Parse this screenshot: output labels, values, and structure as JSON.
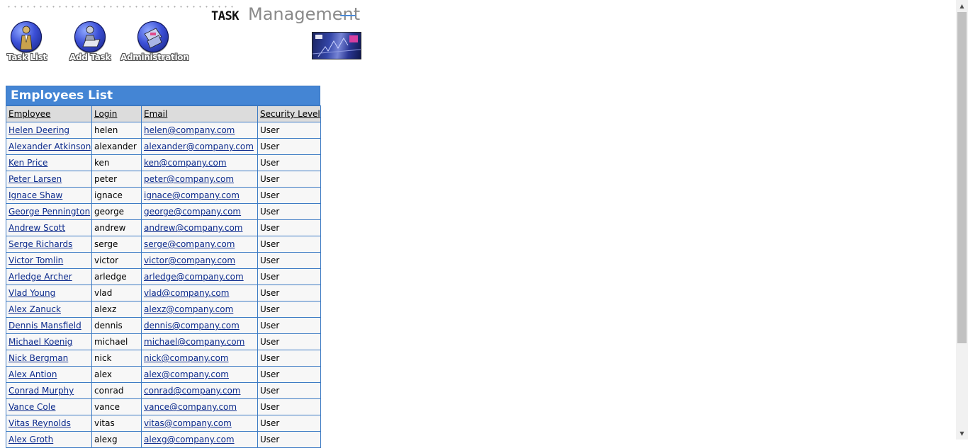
{
  "logo": {
    "task": "TASK",
    "management": "Management"
  },
  "nav": [
    {
      "label": "Task List",
      "icon": "task-list-icon"
    },
    {
      "label": "Add Task",
      "icon": "add-task-icon"
    },
    {
      "label": "Administration",
      "icon": "administration-icon"
    }
  ],
  "panel": {
    "title": "Employees List",
    "columns": [
      "Employee",
      "Login",
      "Email",
      "Security Level"
    ],
    "rows": [
      {
        "name": "Helen Deering",
        "login": "helen",
        "email": "helen@company.com",
        "level": "User"
      },
      {
        "name": "Alexander Atkinson",
        "login": "alexander",
        "email": "alexander@company.com",
        "level": "User"
      },
      {
        "name": "Ken Price",
        "login": "ken",
        "email": "ken@company.com",
        "level": "User"
      },
      {
        "name": "Peter Larsen",
        "login": "peter",
        "email": "peter@company.com",
        "level": "User"
      },
      {
        "name": "Ignace Shaw",
        "login": "ignace",
        "email": "ignace@company.com",
        "level": "User"
      },
      {
        "name": "George Pennington",
        "login": "george",
        "email": "george@company.com",
        "level": "User"
      },
      {
        "name": "Andrew Scott",
        "login": "andrew",
        "email": "andrew@company.com",
        "level": "User"
      },
      {
        "name": "Serge Richards",
        "login": "serge",
        "email": "serge@company.com",
        "level": "User"
      },
      {
        "name": "Victor Tomlin",
        "login": "victor",
        "email": "victor@company.com",
        "level": "User"
      },
      {
        "name": "Arledge Archer",
        "login": "arledge",
        "email": "arledge@company.com",
        "level": "User"
      },
      {
        "name": "Vlad Young",
        "login": "vlad",
        "email": "vlad@company.com",
        "level": "User"
      },
      {
        "name": "Alex Zanuck",
        "login": "alexz",
        "email": "alexz@company.com",
        "level": "User"
      },
      {
        "name": "Dennis Mansfield",
        "login": "dennis",
        "email": "dennis@company.com",
        "level": "User"
      },
      {
        "name": "Michael Koenig",
        "login": "michael",
        "email": "michael@company.com",
        "level": "User"
      },
      {
        "name": "Nick Bergman",
        "login": "nick",
        "email": "nick@company.com",
        "level": "User"
      },
      {
        "name": "Alex Antion",
        "login": "alex",
        "email": "alex@company.com",
        "level": "User"
      },
      {
        "name": "Conrad Murphy",
        "login": "conrad",
        "email": "conrad@company.com",
        "level": "User"
      },
      {
        "name": "Vance Cole",
        "login": "vance",
        "email": "vance@company.com",
        "level": "User"
      },
      {
        "name": "Vitas Reynolds",
        "login": "vitas",
        "email": "vitas@company.com",
        "level": "User"
      },
      {
        "name": "Alex Groth",
        "login": "alexg",
        "email": "alexg@company.com",
        "level": "User"
      }
    ]
  },
  "colors": {
    "header_blue": "#4485d4",
    "link": "#0b2a8c",
    "header_row": "#dcdcdc"
  }
}
